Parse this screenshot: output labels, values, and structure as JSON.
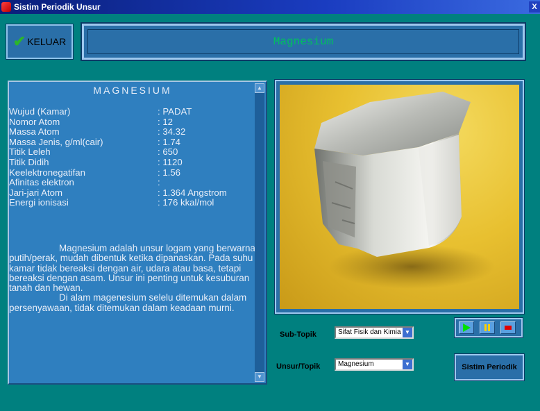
{
  "window": {
    "title": "Sistim Periodik Unsur",
    "close_label": "X"
  },
  "toolbar": {
    "keluar_label": "KELUAR",
    "check_icon": "✔"
  },
  "header": {
    "element_name": "Magnesium"
  },
  "info": {
    "title": "MAGNESIUM",
    "properties": [
      {
        "label": "Wujud (Kamar)",
        "value": ": PADAT"
      },
      {
        "label": "Nomor Atom",
        "value": ": 12"
      },
      {
        "label": "Massa Atom",
        "value": ": 34.32"
      },
      {
        "label": "Massa Jenis, g/ml(cair)",
        "value": ": 1.74"
      },
      {
        "label": "Titik Leleh",
        "value": ": 650"
      },
      {
        "label": "Titik Didih",
        "value": ": 1120"
      },
      {
        "label": "Keelektronegatifan",
        "value": ": 1.56"
      },
      {
        "label": "Afinitas elektron",
        "value": ":"
      },
      {
        "label": "Jari-jari Atom",
        "value": ": 1.364 Angstrom"
      },
      {
        "label": "Energi ionisasi",
        "value": ": 176 kkal/mol"
      }
    ],
    "description": [
      "Magnesium adalah unsur logam yang berwarna putih/perak, mudah dibentuk ketika dipanaskan. Pada suhu kamar tidak bereaksi dengan air, udara atau basa, tetapi bereaksi dengan asam. Unsur ini penting untuk kesuburan tanah dan hewan.",
      "Di alam magenesium selelu ditemukan dalam persenyawaan, tidak ditemukan dalam keadaan murni."
    ]
  },
  "controls": {
    "sub_topik_label": "Sub-Topik",
    "sub_topik_value": "Sifat Fisik dan Kimia",
    "unsur_topik_label": "Unsur/Topik",
    "unsur_topik_value": "Magnesium",
    "sistim_label": "Sistim Periodik"
  },
  "colors": {
    "background": "#00807f",
    "panel": "#2f7fbf",
    "button": "#2a6fa8",
    "title_text": "#00c060",
    "play": "#00e000",
    "pause": "#ffd000",
    "stop": "#e00000"
  }
}
